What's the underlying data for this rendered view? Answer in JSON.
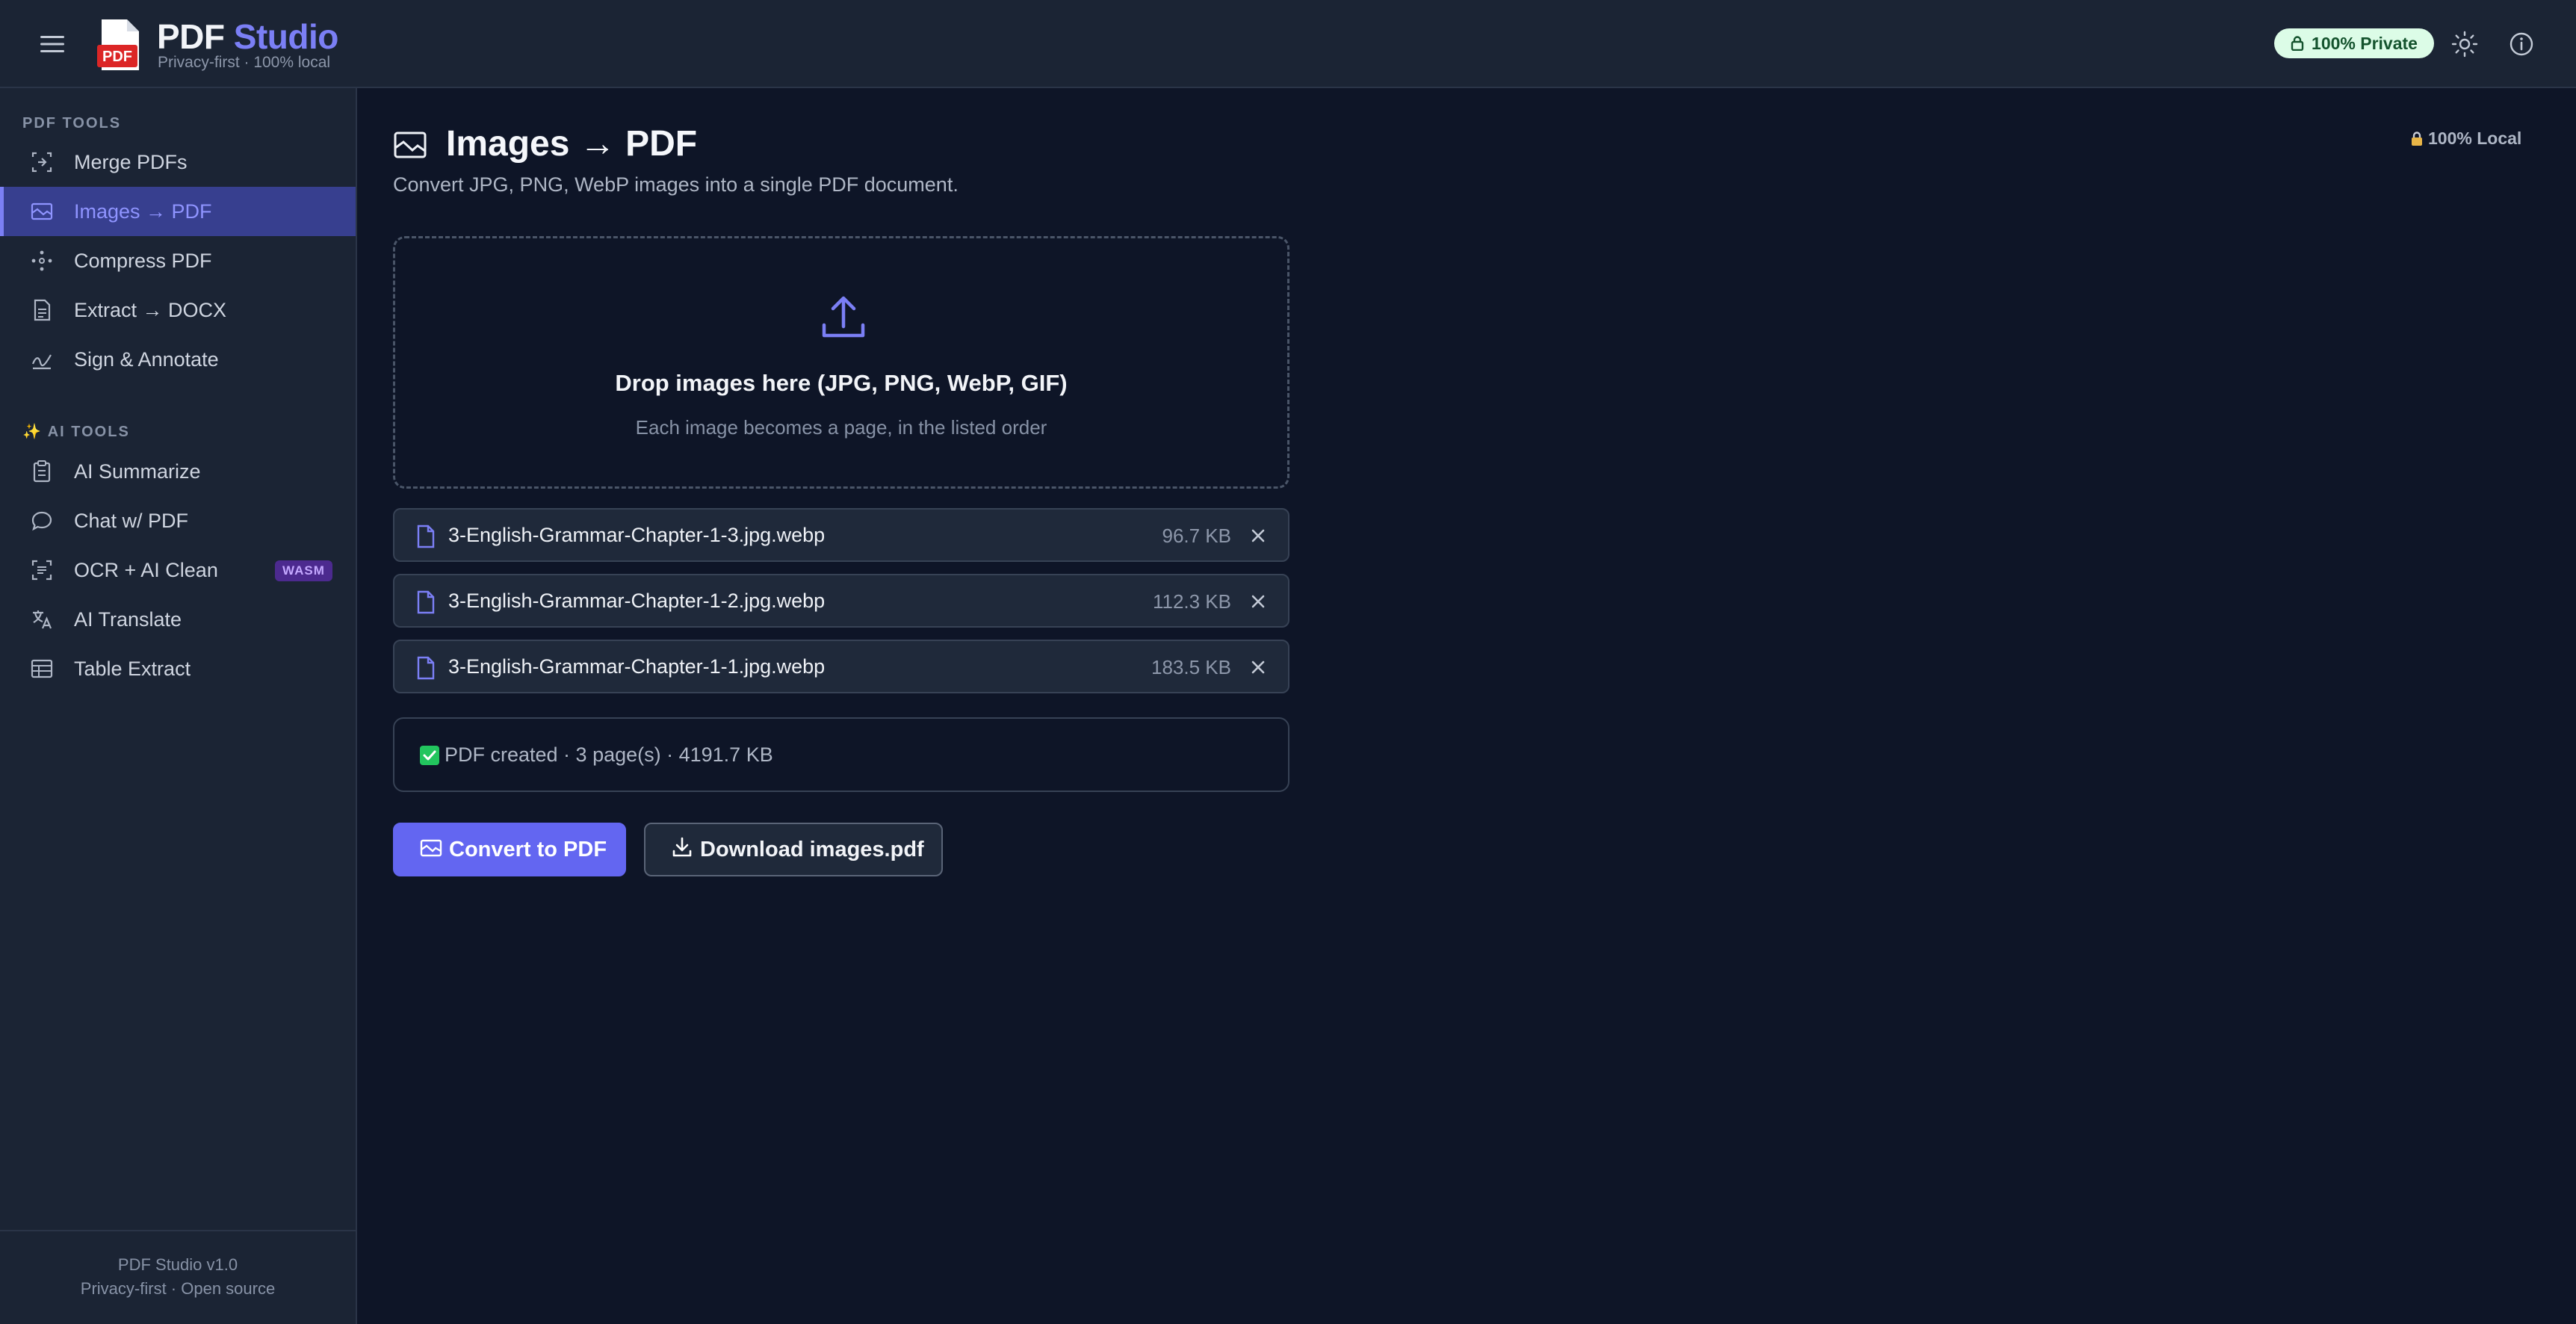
{
  "header": {
    "brand_pdf": "PDF",
    "brand_studio": "Studio",
    "tagline": "Privacy-first · 100% local",
    "private_badge": "100% Private",
    "logo_text": "PDF"
  },
  "sidebar": {
    "pdf_tools_title": "PDF TOOLS",
    "pdf_tools": [
      {
        "label": "Merge PDFs",
        "icon": "merge-icon"
      },
      {
        "label": "Images → PDF",
        "icon": "image-icon",
        "active": true
      },
      {
        "label": "Compress PDF",
        "icon": "compress-icon"
      },
      {
        "label": "Extract → DOCX",
        "icon": "document-icon"
      },
      {
        "label": "Sign & Annotate",
        "icon": "signature-icon"
      }
    ],
    "ai_tools_title": "✨ AI TOOLS",
    "ai_tools": [
      {
        "label": "AI Summarize",
        "icon": "clipboard-icon"
      },
      {
        "label": "Chat w/ PDF",
        "icon": "chat-bubble-icon"
      },
      {
        "label": "OCR + AI Clean",
        "icon": "scan-text-icon",
        "badge": "WASM"
      },
      {
        "label": "AI Translate",
        "icon": "translate-icon"
      },
      {
        "label": "Table Extract",
        "icon": "table-icon"
      }
    ],
    "footer_version": "PDF Studio v1.0",
    "footer_links": "Privacy-first · Open source"
  },
  "main": {
    "title": "Images → PDF",
    "subtitle": "Convert JPG, PNG, WebP images into a single PDF document.",
    "local_chip": "100% Local",
    "dropzone": {
      "title": "Drop images here (JPG, PNG, WebP, GIF)",
      "hint": "Each image becomes a page, in the listed order"
    },
    "files": [
      {
        "name": "3-English-Grammar-Chapter-1-3.jpg.webp",
        "size": "96.7 KB"
      },
      {
        "name": "3-English-Grammar-Chapter-1-2.jpg.webp",
        "size": "112.3 KB"
      },
      {
        "name": "3-English-Grammar-Chapter-1-1.jpg.webp",
        "size": "183.5 KB"
      }
    ],
    "status": "PDF created · 3 page(s) · 4191.7 KB",
    "convert_button": "Convert to PDF",
    "download_button": "Download images.pdf"
  },
  "colors": {
    "accent": "#6366f1",
    "background": "#0e1527",
    "panel": "#1b2434",
    "success": "#22c55e"
  }
}
